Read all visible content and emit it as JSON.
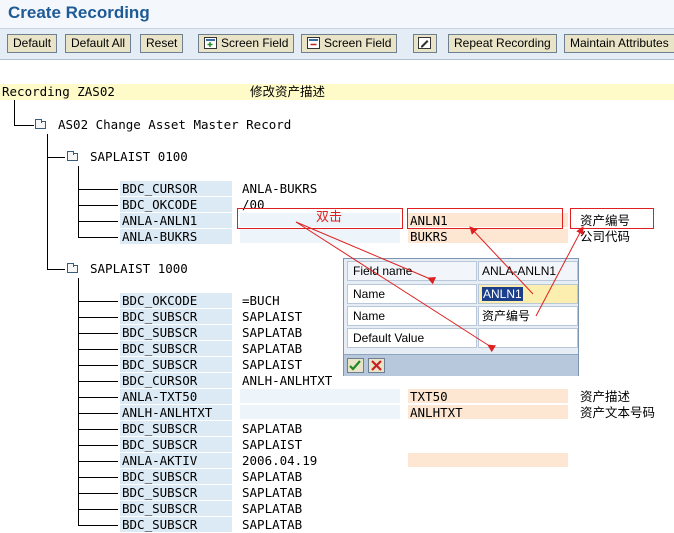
{
  "window": {
    "title": "Create Recording"
  },
  "toolbar": {
    "default": "Default",
    "default_all": "Default All",
    "reset": "Reset",
    "screen_field_1": "Screen Field",
    "screen_field_2": "Screen Field",
    "repeat_recording": "Repeat Recording",
    "maintain_attributes": "Maintain Attributes"
  },
  "recording": {
    "label": "Recording ZAS02",
    "description": "修改资产描述"
  },
  "tree": {
    "root": "AS02 Change Asset Master Record",
    "screen1": {
      "label": "SAPLAIST 0100",
      "rows": [
        {
          "name": "BDC_CURSOR",
          "value": "ANLA-BUKRS",
          "field": "",
          "desc": ""
        },
        {
          "name": "BDC_OKCODE",
          "value": "/00",
          "field": "",
          "desc": ""
        },
        {
          "name": "ANLA-ANLN1",
          "value": "",
          "field": "ANLN1",
          "desc": "资产编号"
        },
        {
          "name": "ANLA-BUKRS",
          "value": "",
          "field": "BUKRS",
          "desc": "公司代码"
        }
      ]
    },
    "screen2": {
      "label": "SAPLAIST 1000",
      "rows": [
        {
          "name": "BDC_OKCODE",
          "value": "=BUCH",
          "field": "",
          "desc": ""
        },
        {
          "name": "BDC_SUBSCR",
          "value": "SAPLAIST",
          "field": "",
          "desc": ""
        },
        {
          "name": "BDC_SUBSCR",
          "value": "SAPLATAB",
          "field": "",
          "desc": ""
        },
        {
          "name": "BDC_SUBSCR",
          "value": "SAPLATAB",
          "field": "",
          "desc": ""
        },
        {
          "name": "BDC_SUBSCR",
          "value": "SAPLAIST",
          "field": "",
          "desc": ""
        },
        {
          "name": "BDC_CURSOR",
          "value": "ANLH-ANLHTXT",
          "field": "",
          "desc": ""
        },
        {
          "name": "ANLA-TXT50",
          "value": "",
          "field": "TXT50",
          "desc": "资产描述"
        },
        {
          "name": "ANLH-ANLHTXT",
          "value": "",
          "field": "ANLHTXT",
          "desc": "资产文本号码"
        },
        {
          "name": "BDC_SUBSCR",
          "value": "SAPLATAB",
          "field": "",
          "desc": ""
        },
        {
          "name": "BDC_SUBSCR",
          "value": "SAPLAIST",
          "field": "",
          "desc": ""
        },
        {
          "name": "ANLA-AKTIV",
          "value": "2006.04.19",
          "field": "",
          "desc": ""
        },
        {
          "name": "BDC_SUBSCR",
          "value": "SAPLATAB",
          "field": "",
          "desc": ""
        },
        {
          "name": "BDC_SUBSCR",
          "value": "SAPLATAB",
          "field": "",
          "desc": ""
        },
        {
          "name": "BDC_SUBSCR",
          "value": "SAPLATAB",
          "field": "",
          "desc": ""
        },
        {
          "name": "BDC_SUBSCR",
          "value": "SAPLATAB",
          "field": "",
          "desc": ""
        }
      ]
    }
  },
  "annotation": {
    "double_click": "双击"
  },
  "popup": {
    "rows": [
      {
        "label": "Field name",
        "value": "ANLA-ANLN1"
      },
      {
        "label": "Name",
        "value": "ANLN1"
      },
      {
        "label": "Name",
        "value": "资产编号"
      },
      {
        "label": "Default Value",
        "value": ""
      }
    ]
  },
  "colors": {
    "title": "#1e5a96",
    "annotation_red": "#e02020",
    "field_name_bg": "#dceaf5",
    "field_value_bg": "#fde7d3",
    "recording_bar": "#fefbc8"
  }
}
